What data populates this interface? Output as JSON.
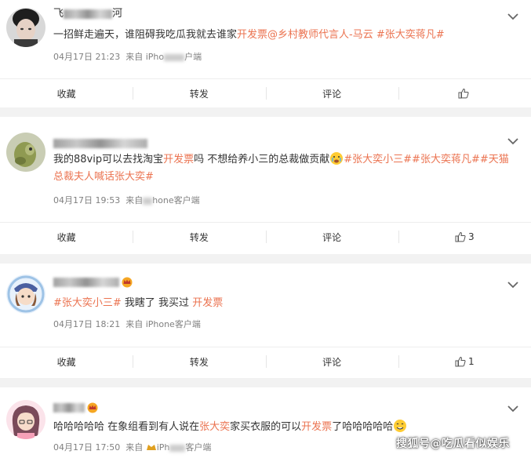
{
  "posts": [
    {
      "name_visible": "飞",
      "name_tail": "河",
      "text_parts": [
        {
          "t": "一招鲜走遍天，谁阻碍我吃瓜我就去谁家",
          "c": "n"
        },
        {
          "t": "开发票",
          "c": "hl"
        },
        {
          "t": "@乡村教师代言人-马云",
          "c": "at"
        },
        {
          "t": " #张大奕蒋凡#",
          "c": "tag"
        }
      ],
      "time": "04月17日 21:23",
      "source_prefix": "来自 iPho",
      "source_suffix": "户端",
      "actions": {
        "fav": "收藏",
        "repost": "转发",
        "comment": "评论",
        "like": ""
      }
    },
    {
      "name_visible": "",
      "name_tail": "",
      "text_parts": [
        {
          "t": "我的88vip可以去找淘宝",
          "c": "n"
        },
        {
          "t": "开发票",
          "c": "hl"
        },
        {
          "t": "吗 不想给养小三的总裁做贡献",
          "c": "n"
        },
        {
          "t": "#张大奕小三##张大奕蒋凡##天猫总裁夫人喊话张大奕#",
          "c": "tag"
        }
      ],
      "time": "04月17日 19:53",
      "source_prefix": "来自",
      "source_suffix": "hone客户端",
      "actions": {
        "fav": "收藏",
        "repost": "转发",
        "comment": "评论",
        "like": "3"
      }
    },
    {
      "name_visible": "",
      "name_tail": "",
      "text_parts": [
        {
          "t": "#张大奕小三#",
          "c": "tag"
        },
        {
          "t": " 我瞎了 我买过 ",
          "c": "n"
        },
        {
          "t": "开发票",
          "c": "hl"
        }
      ],
      "time": "04月17日 18:21",
      "source_prefix": "来自 iPhone客户端",
      "source_suffix": "",
      "actions": {
        "fav": "收藏",
        "repost": "转发",
        "comment": "评论",
        "like": "1"
      }
    },
    {
      "name_visible": "",
      "name_tail": "",
      "text_parts": [
        {
          "t": "哈哈哈哈哈 在象组看到有人说在",
          "c": "n"
        },
        {
          "t": "张大奕",
          "c": "hl"
        },
        {
          "t": "家买衣服的可以",
          "c": "n"
        },
        {
          "t": "开发票",
          "c": "hl"
        },
        {
          "t": "了哈哈哈哈哈",
          "c": "n"
        }
      ],
      "time": "04月17日 17:50",
      "source_prefix": "来自 ",
      "source_suffix": "iPh",
      "source_end": "客户端",
      "actions": {}
    }
  ],
  "watermark": "搜狐号@吃瓜看似娱乐",
  "colors": {
    "highlight": "#eb7350",
    "meta": "#808080",
    "bg": "#f2f2f2"
  }
}
